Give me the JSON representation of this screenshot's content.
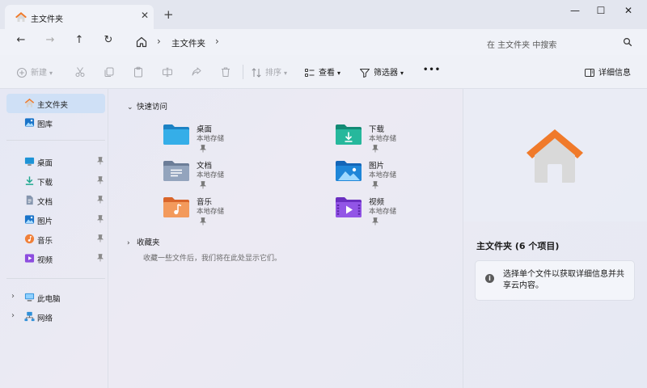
{
  "tab": {
    "title": "主文件夹",
    "close": "✕",
    "new": "+"
  },
  "window": {
    "minimize": "—",
    "maximize": "☐",
    "close": "✕"
  },
  "nav": {
    "back": "←",
    "forward": "→",
    "up": "↑",
    "refresh": "↻"
  },
  "address": {
    "sep1": "›",
    "crumb": "主文件夹",
    "sep2": "›"
  },
  "search": {
    "placeholder": "在 主文件夹 中搜索"
  },
  "commands": {
    "new": "新建",
    "sort": "排序",
    "view": "查看",
    "filter": "筛选器",
    "more": "•••",
    "details": "详细信息"
  },
  "sidebar": {
    "home": "主文件夹",
    "gallery": "图库",
    "pinned": [
      "桌面",
      "下载",
      "文档",
      "图片",
      "音乐",
      "视频"
    ],
    "this_pc": "此电脑",
    "network": "网络",
    "expand": "›"
  },
  "main": {
    "quick_access": {
      "caret": "⌄",
      "title": "快速访问"
    },
    "favorites": {
      "caret": "›",
      "title": "收藏夹",
      "empty_text": "收藏一些文件后，我们将在此处显示它们。"
    },
    "items": [
      {
        "name": "桌面",
        "location": "本地存储"
      },
      {
        "name": "下载",
        "location": "本地存储"
      },
      {
        "name": "文档",
        "location": "本地存储"
      },
      {
        "name": "图片",
        "location": "本地存储"
      },
      {
        "name": "音乐",
        "location": "本地存储"
      },
      {
        "name": "视频",
        "location": "本地存储"
      }
    ]
  },
  "details": {
    "title": "主文件夹 (6 个项目)",
    "info_icon": "i",
    "info": "选择单个文件以获取详细信息并共享云内容。"
  },
  "colors": {
    "accent": "#0a66c2",
    "selection": "#cfe0f6",
    "home_orange": "#f07a2a",
    "desktop_blue": "#1d93d6",
    "downloads_teal": "#1ea88f",
    "music_orange": "#f0803a",
    "videos_purple": "#8d4ddf"
  }
}
